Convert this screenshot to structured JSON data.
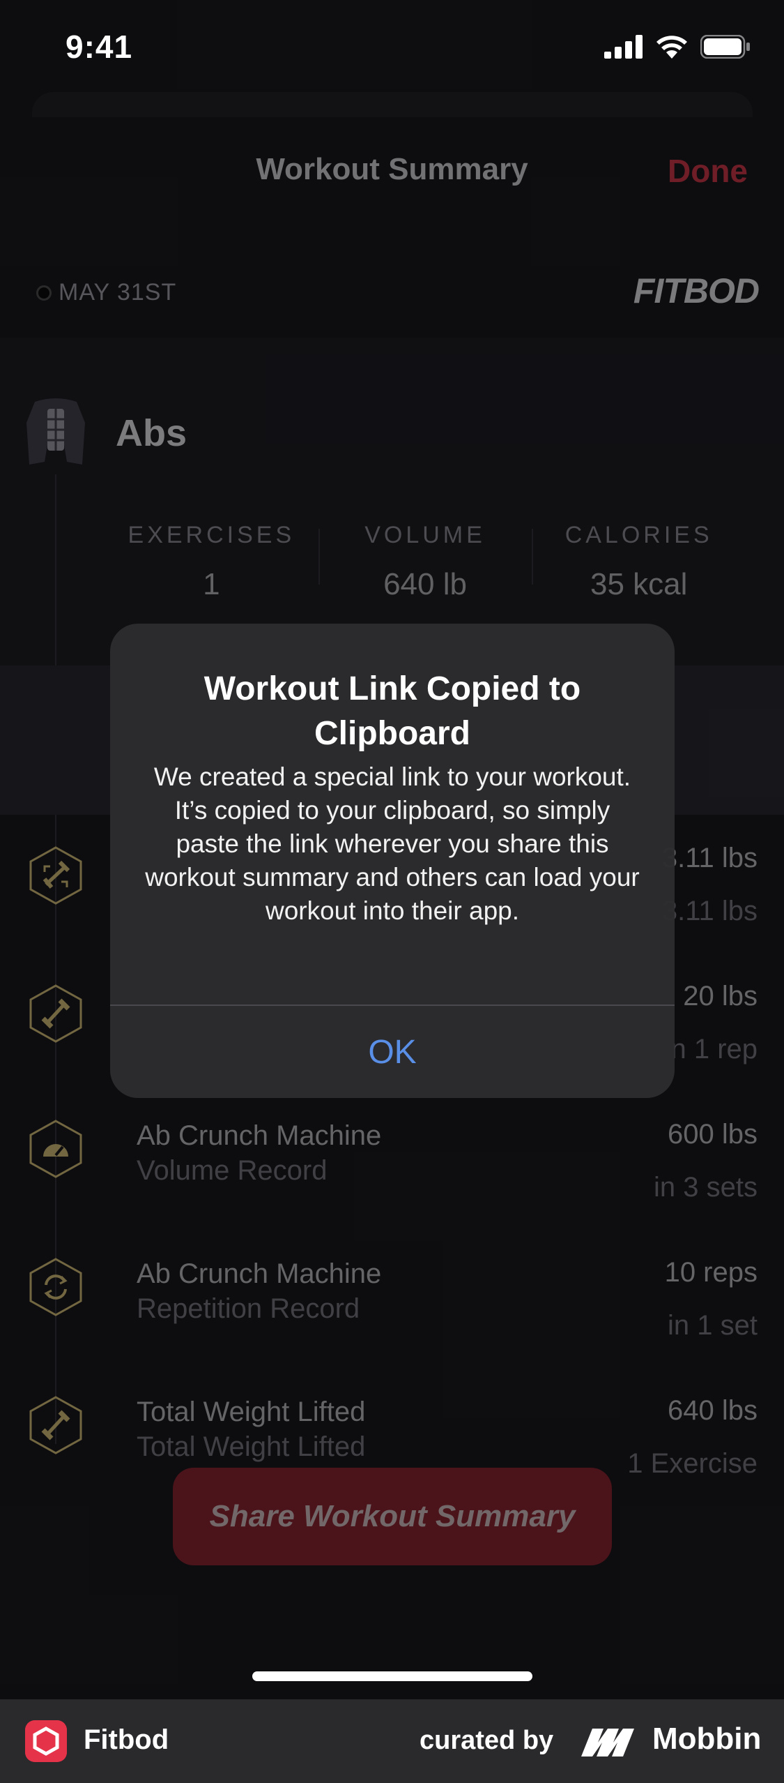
{
  "status_bar": {
    "time": "9:41"
  },
  "header": {
    "title": "Workout Summary",
    "done_label": "Done",
    "date": "MAY 31ST",
    "brand": "FITBOD"
  },
  "summary": {
    "muscle_group": "Abs",
    "stats": [
      {
        "label": "EXERCISES",
        "value": "1"
      },
      {
        "label": "VOLUME",
        "value": "640 lb"
      },
      {
        "label": "CALORIES",
        "value": "35 kcal"
      }
    ]
  },
  "records": [
    {
      "title": "",
      "subtitle": "",
      "value": "3.11 lbs",
      "detail": "3.11 lbs",
      "icon": "dumbbell-arrows-icon"
    },
    {
      "title": "",
      "subtitle": "",
      "value": "20 lbs",
      "detail": "n 1 rep",
      "icon": "dumbbell-icon"
    },
    {
      "title": "Ab Crunch Machine",
      "subtitle": "Volume Record",
      "value": "600 lbs",
      "detail": "in 3 sets",
      "icon": "gauge-icon"
    },
    {
      "title": "Ab Crunch Machine",
      "subtitle": "Repetition Record",
      "value": "10 reps",
      "detail": "in 1 set",
      "icon": "repeat-icon"
    },
    {
      "title": "Total Weight Lifted",
      "subtitle": "Total Weight Lifted",
      "value": "640 lbs",
      "detail": "1 Exercise",
      "icon": "dumbbell-icon"
    }
  ],
  "share_button_label": "Share Workout Summary",
  "alert": {
    "title": "Workout Link Copied to Clipboard",
    "message": "We created a special link to your workout. It’s copied to your clipboard, so simply paste the link wherever you share this workout summary and others can load your workout into their app.",
    "ok_label": "OK"
  },
  "footer": {
    "app_name": "Fitbod",
    "curated_by": "curated by",
    "brand": "Mobbin"
  },
  "colors": {
    "accent_red": "#b3303f",
    "alert_button_blue": "#5a8fe8",
    "icon_gold": "#b9a66a"
  }
}
